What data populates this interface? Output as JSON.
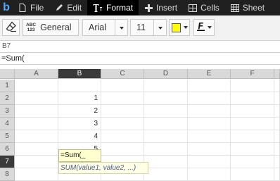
{
  "app": {
    "logo": "b"
  },
  "menu": {
    "tabs": [
      {
        "label": "File",
        "icon": "file-icon"
      },
      {
        "label": "Edit",
        "icon": "pencil-icon"
      },
      {
        "label": "Format",
        "icon": "text-format-icon",
        "active": true
      },
      {
        "label": "Insert",
        "icon": "plus-icon"
      },
      {
        "label": "Cells",
        "icon": "cells-grid-icon"
      },
      {
        "label": "Sheet",
        "icon": "sheet-grid-icon"
      }
    ]
  },
  "toolbar": {
    "clear_format_icon": "eraser-icon",
    "number_format": {
      "icon_top": "ABC",
      "icon_bottom": "123",
      "label": "General"
    },
    "font_family": "Arial",
    "font_size": "11",
    "fill_color": "#ffff00",
    "font_color": "#000000"
  },
  "cell_reference": "B7",
  "formula_bar": {
    "value": "=Sum("
  },
  "grid": {
    "columns": [
      "A",
      "B",
      "C",
      "D",
      "E",
      "F"
    ],
    "selected_column": "B",
    "rows": [
      "1",
      "2",
      "3",
      "4",
      "5",
      "6",
      "7",
      "8"
    ],
    "selected_row": "7",
    "cells_B": [
      "",
      "1",
      "2",
      "3",
      "4",
      "5",
      "",
      ""
    ]
  },
  "editor": {
    "value": "=Sum(_"
  },
  "tooltip": {
    "text": "SUM(value1, value2, ...)"
  }
}
